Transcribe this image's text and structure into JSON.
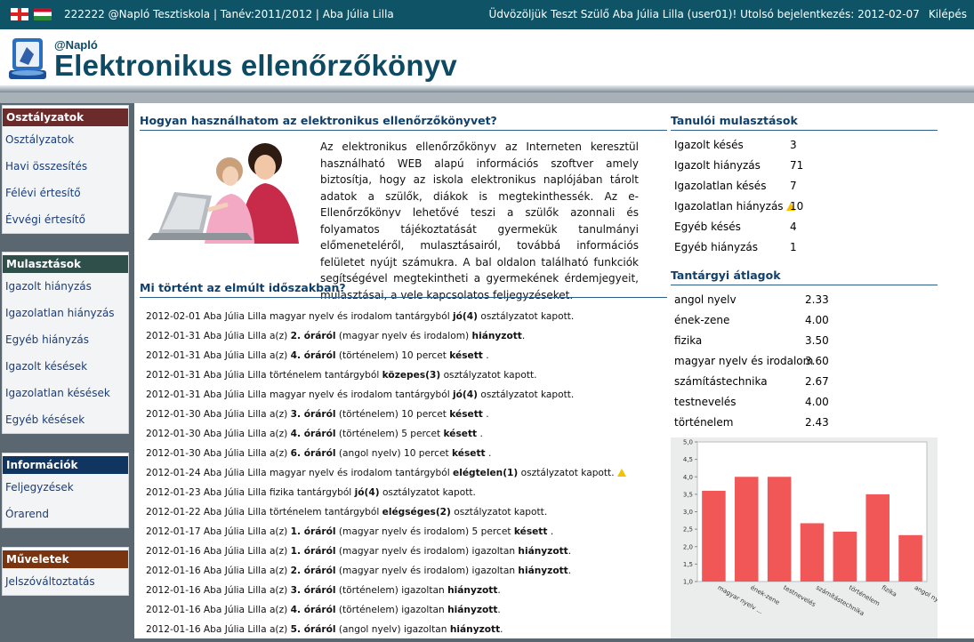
{
  "topbar": {
    "school": "222222 @Napló Tesztiskola | Tanév:2011/2012 | Aba Júlia Lilla",
    "welcome": "Üdvözöljük Teszt Szülő Aba Júlia Lilla (user01)! Utolsó bejelentkezés: 2012-02-07",
    "logout": "Kilépés"
  },
  "header": {
    "brand_small": "@Napló",
    "title": "Elektronikus ellenőrzőkönyv"
  },
  "sidebar": [
    {
      "title": "Osztályzatok",
      "color": "#6b2b2b",
      "items": [
        "Osztályzatok",
        "Havi összesítés",
        "Félévi értesítő",
        "Évvégi értesítő"
      ]
    },
    {
      "title": "Mulasztások",
      "color": "#2f4f4b",
      "items": [
        "Igazolt hiányzás",
        "Igazolatlan hiányzás",
        "Egyéb hiányzás",
        "Igazolt késések",
        "Igazolatlan késések",
        "Egyéb késések"
      ]
    },
    {
      "title": "Információk",
      "color": "#0f3560",
      "items": [
        "Feljegyzések",
        "Órarend"
      ]
    },
    {
      "title": "Műveletek",
      "color": "#7a3510",
      "items": [
        "Jelszóváltoztatás"
      ]
    }
  ],
  "intro": {
    "title": "Hogyan használhatom az elektronikus ellenőrzőkönyvet?",
    "text": "Az elektronikus ellenőrzőkönyv az Interneten keresztül használható WEB alapú információs szoftver amely biztosítja, hogy az iskola elektronikus naplójában tárolt adatok a szülők, diákok is megtekinthessék. Az e-Ellenőrzőkönyv lehetővé teszi a szülők azonnali és folyamatos tájékoztatását gyermekük tanulmányi előmeneteléről, mulasztásairól, továbbá információs felületet nyújt számukra. A bal oldalon található funkciók segítségével megtekintheti a gyermekének érdemjegyeit, mulasztásai, a vele kapcsolatos feljegyzéseket."
  },
  "events_title": "Mi történt az elmúlt időszakban?",
  "events": [
    {
      "pre": "2012-02-01 Aba Júlia Lilla magyar nyelv és irodalom tantárgyból ",
      "bold": "jó(4)",
      "post": " osztályzatot kapott.",
      "warn": false
    },
    {
      "pre": "2012-01-31 Aba Júlia Lilla a(z) ",
      "bold": "2. óráról",
      "post": " (magyar nyelv és irodalom) ",
      "bold2": "hiányzott",
      "post2": ".",
      "warn": false
    },
    {
      "pre": "2012-01-31 Aba Júlia Lilla a(z) ",
      "bold": "4. óráról",
      "post": " (történelem) 10 percet ",
      "bold2": "késett",
      "post2": " .",
      "warn": false
    },
    {
      "pre": "2012-01-31 Aba Júlia Lilla történelem tantárgyból ",
      "bold": "közepes(3)",
      "post": " osztályzatot kapott.",
      "warn": false
    },
    {
      "pre": "2012-01-31 Aba Júlia Lilla magyar nyelv és irodalom tantárgyból ",
      "bold": "jó(4)",
      "post": " osztályzatot kapott.",
      "warn": false
    },
    {
      "pre": "2012-01-30 Aba Júlia Lilla a(z) ",
      "bold": "3. óráról",
      "post": " (történelem) 10 percet ",
      "bold2": "késett",
      "post2": " .",
      "warn": false
    },
    {
      "pre": "2012-01-30 Aba Júlia Lilla a(z) ",
      "bold": "4. óráról",
      "post": " (történelem) 5 percet ",
      "bold2": "késett",
      "post2": " .",
      "warn": false
    },
    {
      "pre": "2012-01-30 Aba Júlia Lilla a(z) ",
      "bold": "6. óráról",
      "post": " (angol nyelv) 10 percet ",
      "bold2": "késett",
      "post2": " .",
      "warn": false
    },
    {
      "pre": "2012-01-24 Aba Júlia Lilla magyar nyelv és irodalom tantárgyból ",
      "bold": "elégtelen(1)",
      "post": " osztályzatot kapott.",
      "warn": true
    },
    {
      "pre": "2012-01-23 Aba Júlia Lilla fizika tantárgyból ",
      "bold": "jó(4)",
      "post": " osztályzatot kapott.",
      "warn": false
    },
    {
      "pre": "2012-01-22 Aba Júlia Lilla történelem tantárgyból ",
      "bold": "elégséges(2)",
      "post": " osztályzatot kapott.",
      "warn": false
    },
    {
      "pre": "2012-01-17 Aba Júlia Lilla a(z) ",
      "bold": "1. óráról",
      "post": " (magyar nyelv és irodalom) 5 percet ",
      "bold2": "késett",
      "post2": " .",
      "warn": false
    },
    {
      "pre": "2012-01-16 Aba Júlia Lilla a(z) ",
      "bold": "1. óráról",
      "post": " (magyar nyelv és irodalom) igazoltan ",
      "bold2": "hiányzott",
      "post2": ".",
      "warn": false
    },
    {
      "pre": "2012-01-16 Aba Júlia Lilla a(z) ",
      "bold": "2. óráról",
      "post": " (magyar nyelv és irodalom) igazoltan ",
      "bold2": "hiányzott",
      "post2": ".",
      "warn": false
    },
    {
      "pre": "2012-01-16 Aba Júlia Lilla a(z) ",
      "bold": "3. óráról",
      "post": " (történelem) igazoltan ",
      "bold2": "hiányzott",
      "post2": ".",
      "warn": false
    },
    {
      "pre": "2012-01-16 Aba Júlia Lilla a(z) ",
      "bold": "4. óráról",
      "post": " (történelem) igazoltan ",
      "bold2": "hiányzott",
      "post2": ".",
      "warn": false
    },
    {
      "pre": "2012-01-16 Aba Júlia Lilla a(z) ",
      "bold": "5. óráról",
      "post": " (angol nyelv) igazoltan ",
      "bold2": "hiányzott",
      "post2": ".",
      "warn": false
    }
  ],
  "absences": {
    "title": "Tanulói mulasztások",
    "rows": [
      {
        "label": "Igazolt késés",
        "value": "3",
        "warn": false
      },
      {
        "label": "Igazolt hiányzás",
        "value": "71",
        "warn": false
      },
      {
        "label": "Igazolatlan késés",
        "value": "7",
        "warn": false
      },
      {
        "label": "Igazolatlan hiányzás",
        "value": "10",
        "warn": true
      },
      {
        "label": "Egyéb késés",
        "value": "4",
        "warn": false
      },
      {
        "label": "Egyéb hiányzás",
        "value": "1",
        "warn": false
      }
    ]
  },
  "averages": {
    "title": "Tantárgyi átlagok",
    "rows": [
      {
        "label": "angol nyelv",
        "value": "2.33"
      },
      {
        "label": "ének-zene",
        "value": "4.00"
      },
      {
        "label": "fizika",
        "value": "3.50"
      },
      {
        "label": "magyar nyelv és irodalom",
        "value": "3.60"
      },
      {
        "label": "számítástechnika",
        "value": "2.67"
      },
      {
        "label": "testnevelés",
        "value": "4.00"
      },
      {
        "label": "történelem",
        "value": "2.43"
      }
    ]
  },
  "chart_data": {
    "type": "bar",
    "categories": [
      "magyar nyelv ...",
      "ének-zene",
      "testnevelés",
      "számítástechnika",
      "történelem",
      "fizika",
      "angol nyelv"
    ],
    "values": [
      3.6,
      4.0,
      4.0,
      2.67,
      2.43,
      3.5,
      2.33
    ],
    "yticks": [
      "1,0",
      "1,5",
      "2,0",
      "2,5",
      "3,0",
      "3,5",
      "4,0",
      "4,5",
      "5,0"
    ],
    "ylim": [
      1,
      5
    ],
    "bar_color": "#f25757"
  }
}
